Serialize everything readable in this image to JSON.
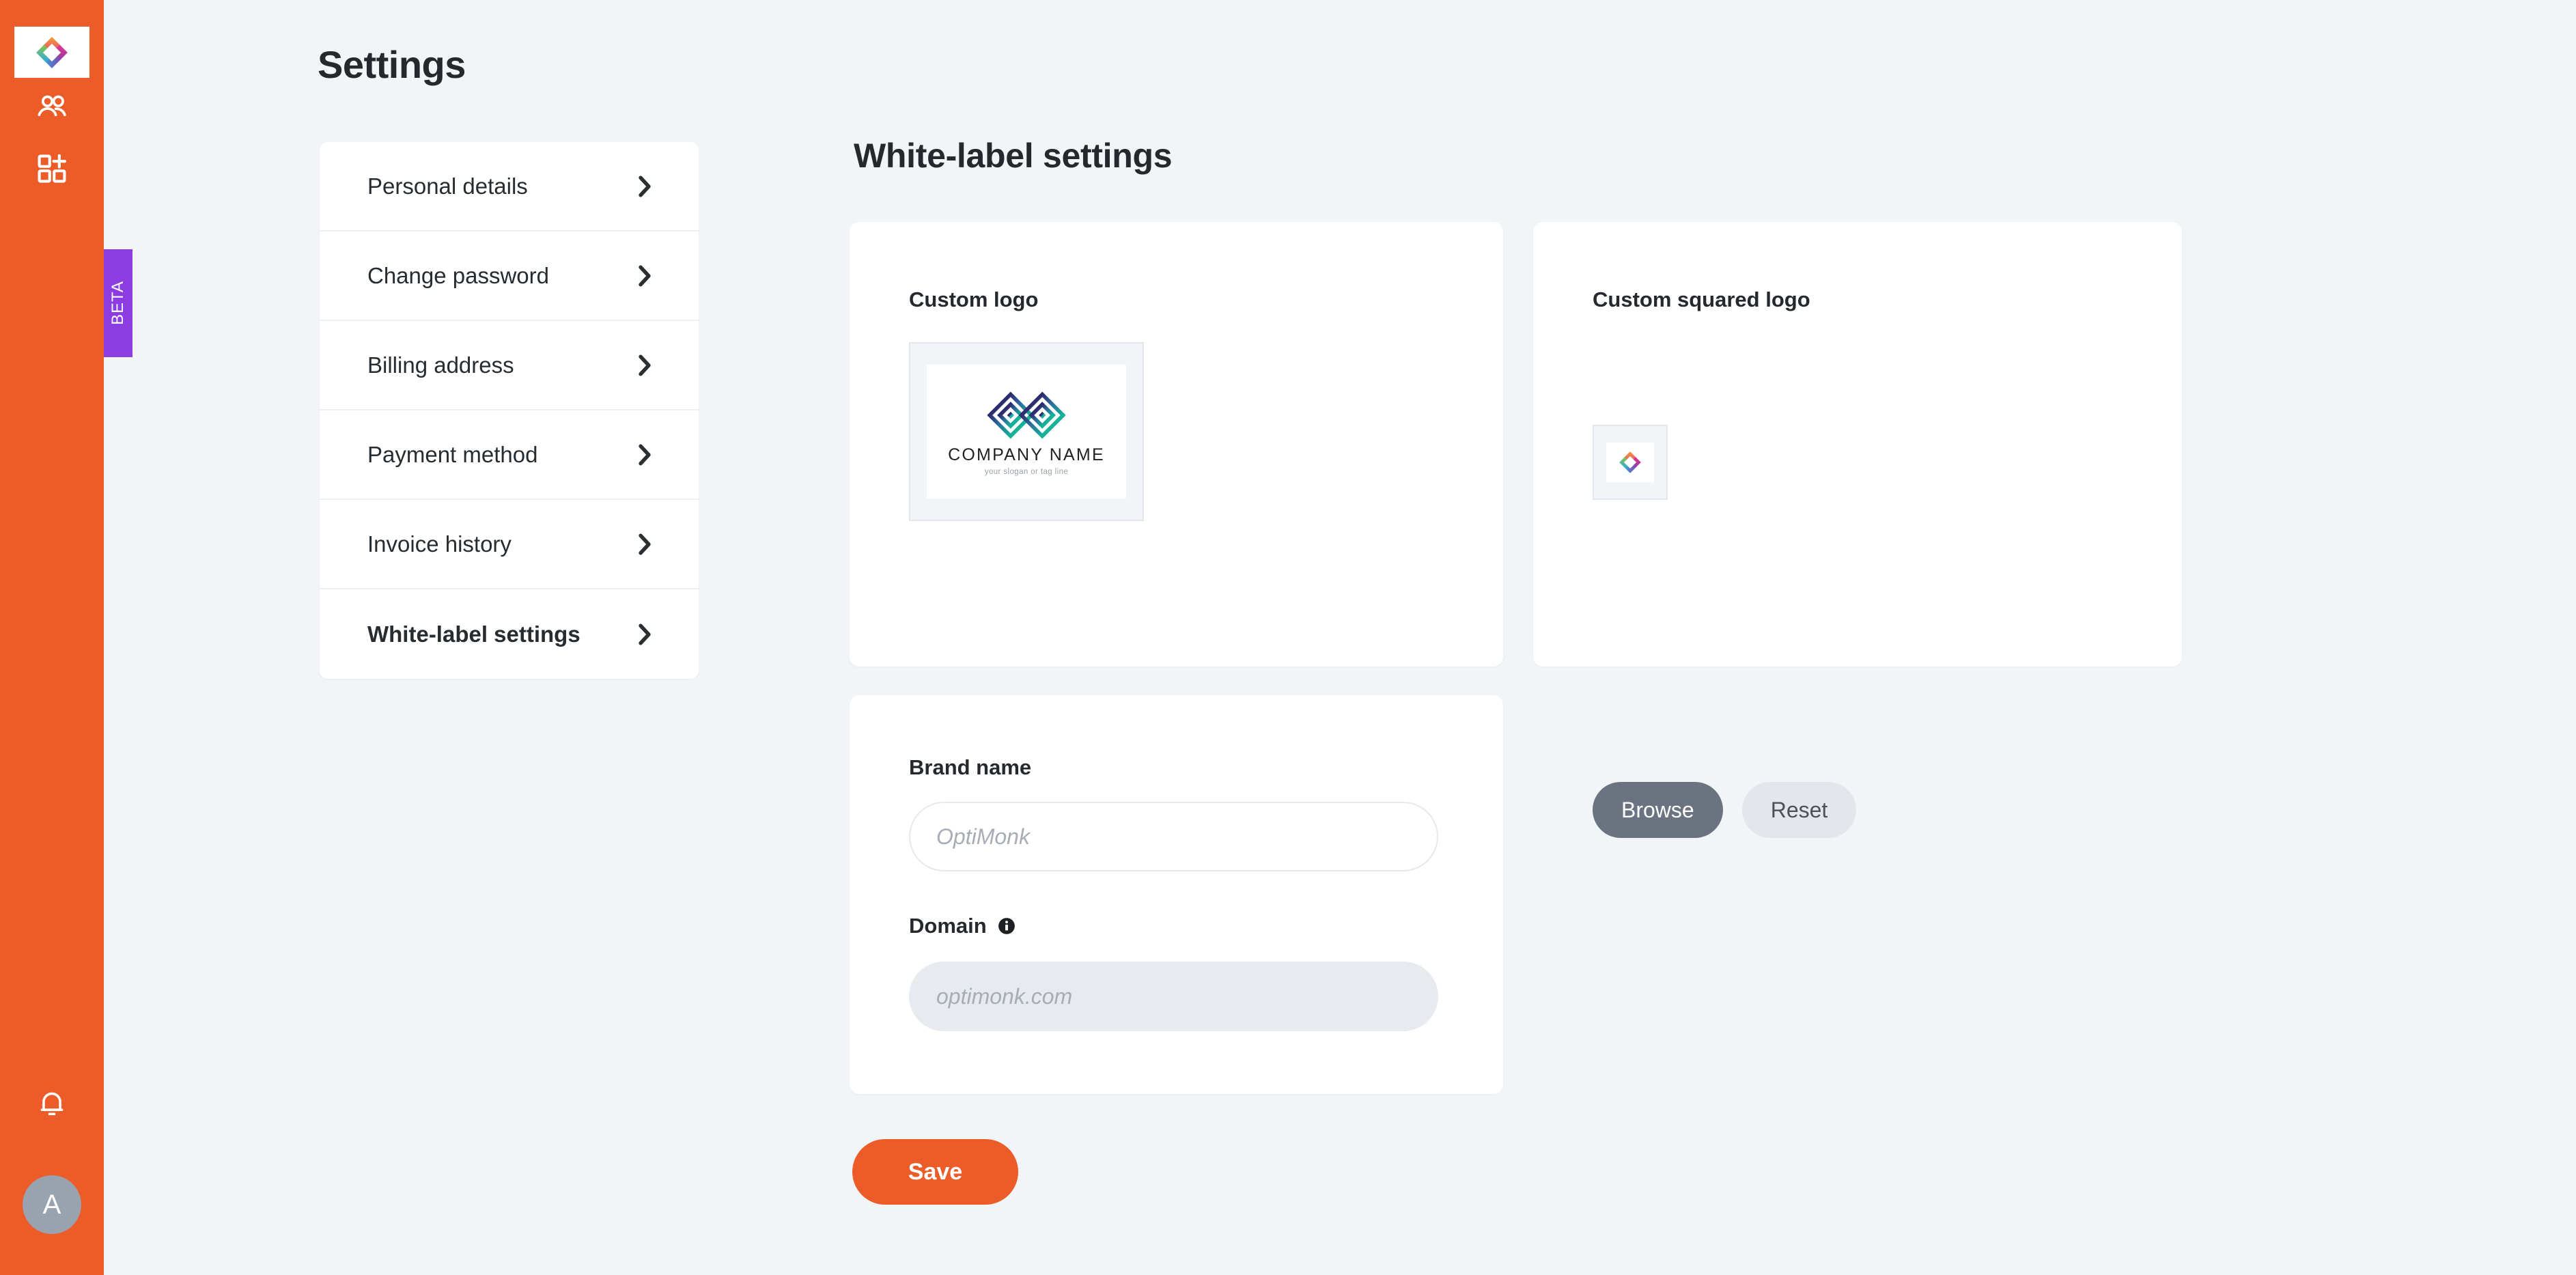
{
  "colors": {
    "rail_background": "#ec5c29",
    "page_background": "#f2f5f8",
    "card_background": "#ffffff",
    "accent": "#ec5c29",
    "beta_badge": "#8c3ce0",
    "browse_button": "#6b7280",
    "reset_button": "#e3e6ea",
    "avatar": "#99a2af"
  },
  "rail": {
    "logo_icon": "optimonk-diamond-logo-icon",
    "items": [
      {
        "icon": "users-icon",
        "name": "audiences"
      },
      {
        "icon": "apps-add-icon",
        "name": "apps"
      }
    ],
    "beta_label": "BETA",
    "bell_icon": "bell-icon",
    "avatar_initial": "A"
  },
  "page": {
    "title": "Settings"
  },
  "settings_menu": {
    "items": [
      {
        "label": "Personal details",
        "active": false,
        "chevron": "chevron-right-icon"
      },
      {
        "label": "Change password",
        "active": false,
        "chevron": "chevron-right-icon"
      },
      {
        "label": "Billing address",
        "active": false,
        "chevron": "chevron-right-icon"
      },
      {
        "label": "Payment method",
        "active": false,
        "chevron": "chevron-right-icon"
      },
      {
        "label": "Invoice history",
        "active": false,
        "chevron": "chevron-right-icon"
      },
      {
        "label": "White-label settings",
        "active": true,
        "chevron": "chevron-right-icon"
      }
    ]
  },
  "content": {
    "title": "White-label settings",
    "custom_logo": {
      "label": "Custom logo",
      "preview": {
        "company_name": "COMPANY NAME",
        "slogan": "your slogan or tag line",
        "mark_icon": "geometric-diamond-logo-icon"
      },
      "browse_label": "Browse",
      "reset_label": "Reset"
    },
    "custom_squared_logo": {
      "label": "Custom squared logo",
      "preview": {
        "mark_icon": "optimonk-diamond-logo-icon"
      },
      "browse_label": "Browse",
      "reset_label": "Reset"
    },
    "brand_form": {
      "brand_name_label": "Brand name",
      "brand_name_value": "",
      "brand_name_placeholder": "OptiMonk",
      "domain_label": "Domain",
      "domain_info_icon": "info-icon",
      "domain_value": "",
      "domain_placeholder": "optimonk.com"
    },
    "save_label": "Save"
  }
}
